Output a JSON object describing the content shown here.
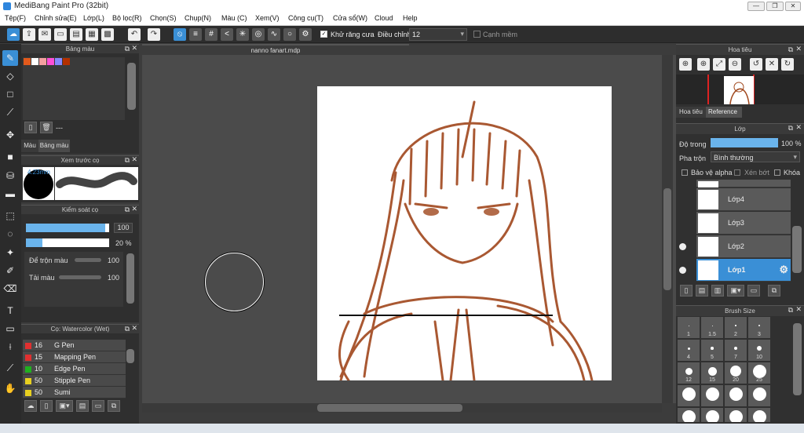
{
  "window": {
    "title": "MediBang Paint Pro (32bit)",
    "min": "—",
    "restore": "❐",
    "close": "✕"
  },
  "menu": [
    "Tệp(F)",
    "Chỉnh sửa(E)",
    "Lớp(L)",
    "Bộ lọc(R)",
    "Chọn(S)",
    "Chụp(N)",
    "Màu (C)",
    "Xem(V)",
    "Công cụ(T)",
    "Cửa sổ(W)",
    "Cloud",
    "Help"
  ],
  "toolbar": {
    "antialias_label": "Khử răng cưa",
    "adjust_label": "Điều chỉnh",
    "adjust_value": "12",
    "smooth_edge_label": "Cạnh mềm"
  },
  "palette": {
    "title": "Bảng màu",
    "colors": [
      "#e25a1c",
      "#ffffff",
      "#f4a0a0",
      "#ff4fd8",
      "#8888ff",
      "#b33000"
    ],
    "status": "---",
    "tabs": [
      "Màu",
      "Bảng màu"
    ]
  },
  "brush_preview": {
    "title": "Xem trước cọ",
    "size": "4.23mm"
  },
  "brush_control": {
    "title": "Kiểm soát cọ",
    "size_value": "100",
    "opacity_value": "20 %",
    "mix_label": "Để trộn màu",
    "mix_value": "100",
    "reload_label": "Tải màu",
    "reload_value": "100",
    "size_fill": 0.95,
    "opacity_fill": 0.2,
    "mix_fill": 1.0,
    "reload_fill": 1.0
  },
  "brush_list": {
    "title": "Cọ: Watercolor (Wet)",
    "items": [
      {
        "size": "16",
        "name": "G Pen",
        "color": "#e03030"
      },
      {
        "size": "15",
        "name": "Mapping Pen",
        "color": "#e03030"
      },
      {
        "size": "10",
        "name": "Edge Pen",
        "color": "#20b020"
      },
      {
        "size": "50",
        "name": "Stipple Pen",
        "color": "#e8d020"
      },
      {
        "size": "50",
        "name": "Sumi",
        "color": "#e8d020"
      }
    ]
  },
  "document": {
    "tab": "nanno fanart.mdp"
  },
  "navigator": {
    "title": "Hoa tiêu",
    "tabs": [
      "Hoa tiêu",
      "Reference"
    ]
  },
  "layers": {
    "title": "Lớp",
    "opacity_label": "Độ trong",
    "opacity_value": "100 %",
    "opacity_fill": 1.0,
    "blend_label": "Pha trộn",
    "blend_value": "Bình thường",
    "protect_alpha": "Bảo vệ alpha",
    "clipping": "Xén bớt",
    "lock": "Khóa",
    "items": [
      {
        "name": "Lớp4",
        "selected": false
      },
      {
        "name": "Lớp3",
        "selected": false
      },
      {
        "name": "Lớp2",
        "selected": false
      },
      {
        "name": "Lớp1",
        "selected": true
      }
    ]
  },
  "brush_size": {
    "title": "Brush Size",
    "sizes": [
      "1",
      "1.5",
      "2",
      "3",
      "4",
      "5",
      "7",
      "10",
      "12",
      "15",
      "20",
      "25"
    ]
  }
}
